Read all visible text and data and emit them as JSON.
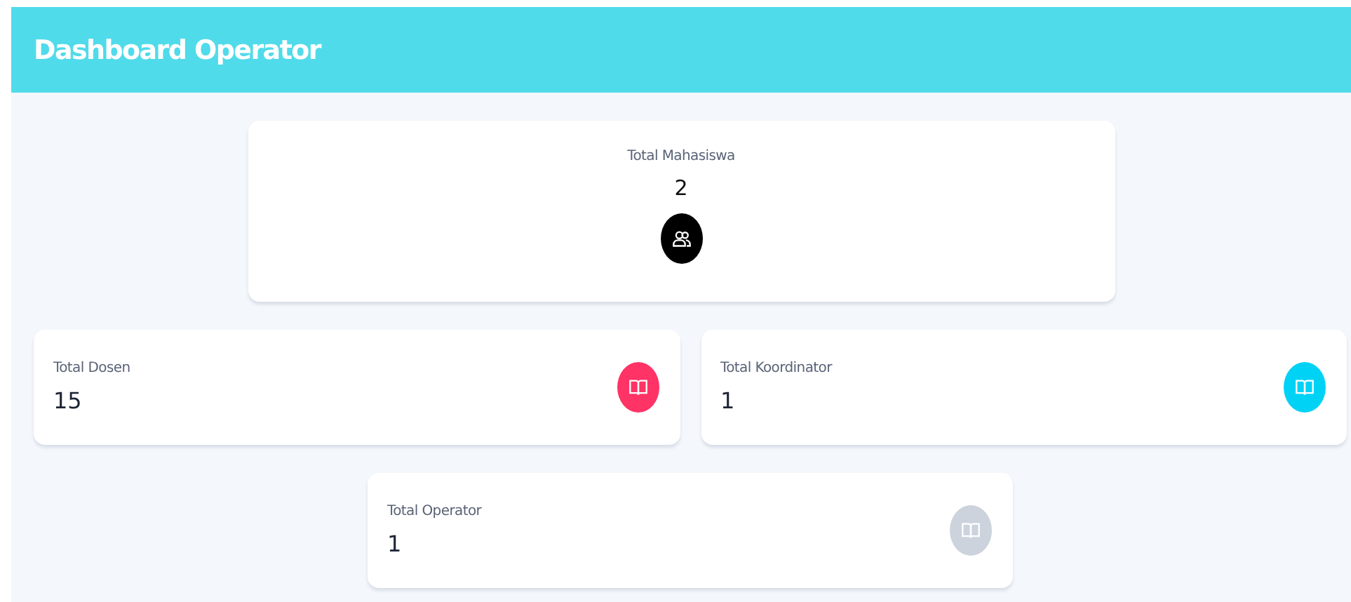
{
  "header": {
    "title": "Dashboard Operator"
  },
  "cards": [
    {
      "kind": "centered",
      "label": "Total Mahasiswa",
      "value": "2",
      "color": "#000000"
    },
    {
      "kind": "side",
      "label": "Total Dosen",
      "value": "15",
      "color": "#ff3366"
    },
    {
      "kind": "side",
      "label": "Total Koordinator",
      "value": "1",
      "color": "#00d2f5"
    },
    {
      "kind": "side",
      "label": "Total Operator",
      "value": "1",
      "color": "#cdd3dd"
    }
  ]
}
